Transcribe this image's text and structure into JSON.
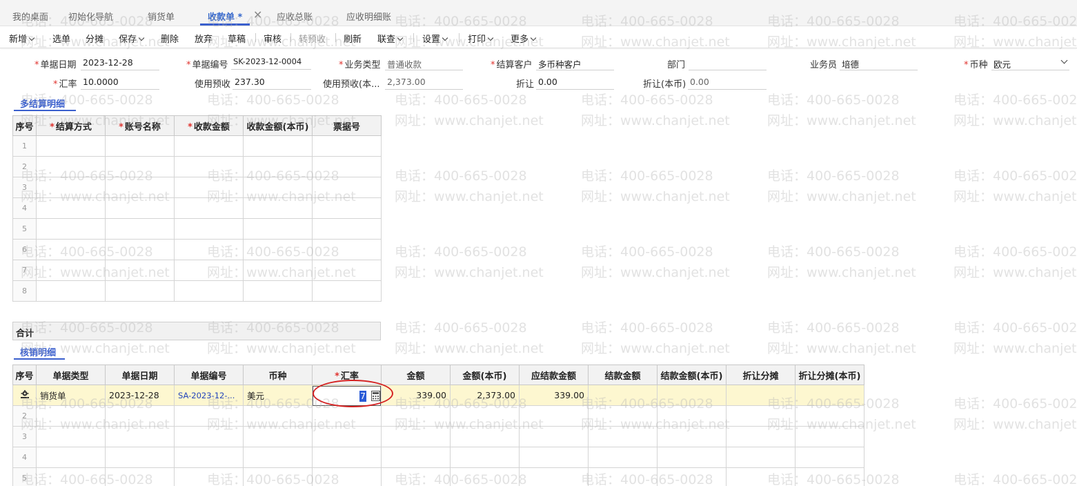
{
  "tabs": [
    {
      "label": "我的桌面"
    },
    {
      "label": "初始化导航"
    },
    {
      "label": "销货单"
    },
    {
      "label": "收款单 *"
    },
    {
      "label": "应收总账"
    },
    {
      "label": "应收明细账"
    }
  ],
  "toolbar": {
    "new": "新增",
    "select": "选单",
    "allocate": "分摊",
    "save": "保存",
    "delete": "删除",
    "discard": "放弃",
    "draft": "草稿",
    "audit": "审核",
    "to_prepay": "转预收",
    "refresh": "刷新",
    "linked": "联查",
    "settings": "设置",
    "print": "打印",
    "more": "更多"
  },
  "form": {
    "doc_date_label": "单据日期",
    "doc_date": "2023-12-28",
    "doc_no_label": "单据编号",
    "doc_no": "SK-2023-12-0004",
    "biz_type_label": "业务类型",
    "biz_type": "普通收款",
    "customer_label": "结算客户",
    "customer": "多币种客户",
    "dept_label": "部门",
    "dept": "",
    "salesman_label": "业务员",
    "salesman": "培德",
    "currency_label": "币种",
    "currency": "欧元",
    "rate_label": "汇率",
    "rate": "10.0000",
    "use_prepay_label": "使用预收",
    "use_prepay": "237.30",
    "use_prepay_local_label": "使用预收(本...",
    "use_prepay_local": "2,373.00",
    "discount_label": "折让",
    "discount": "0.00",
    "discount_local_label": "折让(本币)",
    "discount_local": "0.00"
  },
  "settlement": {
    "title": "多结算明细",
    "headers": [
      "序号",
      "结算方式",
      "账号名称",
      "收款金额",
      "收款金额(本币)",
      "票据号"
    ],
    "rows": [
      "1",
      "2",
      "3",
      "4",
      "5",
      "6",
      "7",
      "8"
    ],
    "total_label": "合计"
  },
  "writeoff": {
    "title": "核销明细",
    "headers": [
      "序号",
      "单据类型",
      "单据日期",
      "单据编号",
      "币种",
      "汇率",
      "金额",
      "金额(本币)",
      "应结款金额",
      "结款金额",
      "结款金额(本币)",
      "折让分摊",
      "折让分摊(本币)"
    ],
    "row1": {
      "doc_type": "销货单",
      "doc_date": "2023-12-28",
      "doc_no": "SA-2023-12-...",
      "currency": "美元",
      "rate_edit": "7",
      "amount": "339.00",
      "amount_local": "2,373.00",
      "due": "339.00"
    },
    "rows": [
      "2",
      "3",
      "4",
      "5"
    ]
  },
  "watermark": {
    "phone": "电话：400-665-0028",
    "site": "网址：www.chanjet.net"
  },
  "colors": {
    "accent": "#3a5fcd",
    "required": "#e0332f",
    "highlight_row": "#fdf7d0",
    "annotation": "#d52222"
  }
}
